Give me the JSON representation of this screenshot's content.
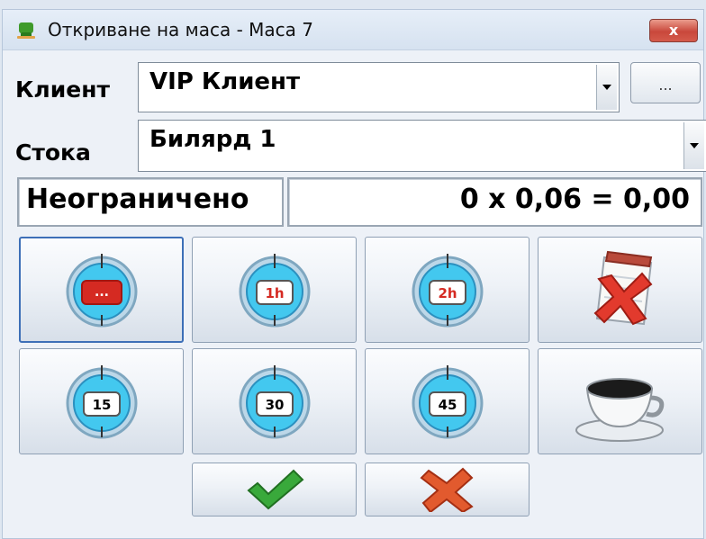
{
  "window": {
    "title": "Откриване на маса - Маса 7",
    "close_label": "x"
  },
  "client": {
    "label": "Клиент",
    "value": "VIP Клиент",
    "browse_label": "..."
  },
  "product": {
    "label": "Стока",
    "value": "Билярд 1"
  },
  "duration": {
    "value": "Неограничено"
  },
  "calculation": {
    "value": "0 x 0,06 = 0,00"
  },
  "buttons": {
    "unlimited_label": "...",
    "one_hour_label": "1h",
    "two_hours_label": "2h",
    "minutes_15_label": "15",
    "minutes_30_label": "30",
    "minutes_45_label": "45"
  },
  "colors": {
    "clock_face": "#43c8ef",
    "clock_badge_red": "#d52a22",
    "confirm_green": "#39a93b",
    "cancel_red": "#e25a2e"
  }
}
